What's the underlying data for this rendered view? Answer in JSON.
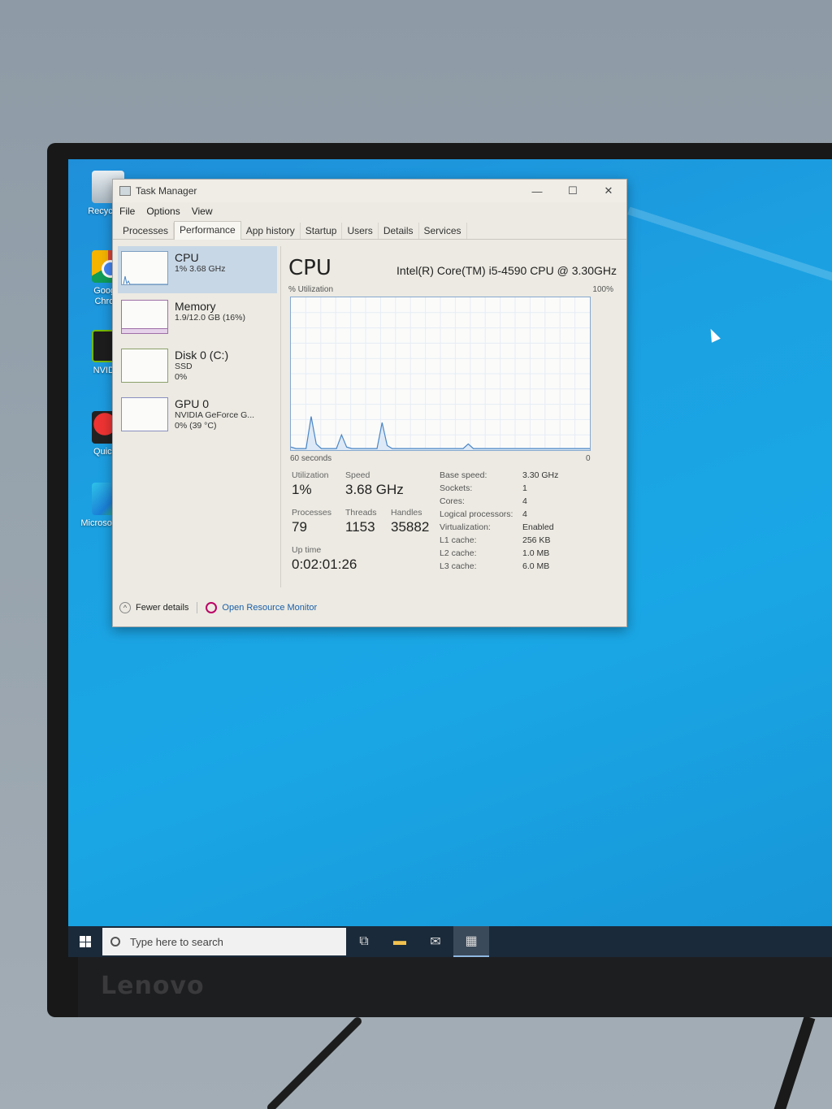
{
  "monitor": {
    "brand": "Lenovo"
  },
  "desktop": {
    "icons": [
      {
        "label": "Recycle B",
        "icon": "recycle-bin-icon"
      },
      {
        "label": "Google Chrom",
        "icon": "chrome-icon"
      },
      {
        "label": "NVIDIA",
        "icon": "nvidia-icon"
      },
      {
        "label": "QuickC",
        "icon": "quickcpu-icon"
      },
      {
        "label": "Microso Edge",
        "icon": "edge-icon"
      }
    ]
  },
  "window": {
    "title": "Task Manager",
    "controls": {
      "minimize": "—",
      "maximize": "☐",
      "close": "✕"
    },
    "menu": [
      "File",
      "Options",
      "View"
    ],
    "tabs": [
      "Processes",
      "Performance",
      "App history",
      "Startup",
      "Users",
      "Details",
      "Services"
    ],
    "active_tab": "Performance"
  },
  "sidebar": {
    "items": [
      {
        "name": "CPU",
        "line1": "1%  3.68 GHz",
        "line2": ""
      },
      {
        "name": "Memory",
        "line1": "1.9/12.0 GB (16%)",
        "line2": ""
      },
      {
        "name": "Disk 0 (C:)",
        "line1": "SSD",
        "line2": "0%"
      },
      {
        "name": "GPU 0",
        "line1": "NVIDIA GeForce G...",
        "line2": "0%  (39 °C)"
      }
    ]
  },
  "cpu": {
    "title": "CPU",
    "model": "Intel(R) Core(TM) i5-4590 CPU @ 3.30GHz",
    "util_label": "% Utilization",
    "util_max": "100%",
    "time_label": "60 seconds",
    "zero_label": "0",
    "history": [
      2,
      1,
      1,
      1,
      22,
      4,
      1,
      1,
      1,
      1,
      10,
      2,
      1,
      1,
      1,
      1,
      1,
      1,
      18,
      3,
      1,
      1,
      1,
      1,
      1,
      1,
      1,
      1,
      1,
      1,
      1,
      1,
      1,
      1,
      1,
      4,
      1,
      1,
      1,
      1,
      1,
      1,
      1,
      1,
      1,
      1,
      1,
      1,
      1,
      1,
      1,
      1,
      1,
      1,
      1,
      1,
      1,
      1,
      1,
      1
    ],
    "stats": {
      "utilization_label": "Utilization",
      "utilization": "1%",
      "speed_label": "Speed",
      "speed": "3.68 GHz",
      "processes_label": "Processes",
      "processes": "79",
      "threads_label": "Threads",
      "threads": "1153",
      "handles_label": "Handles",
      "handles": "35882",
      "uptime_label": "Up time",
      "uptime": "0:02:01:26"
    },
    "specs": [
      {
        "k": "Base speed:",
        "v": "3.30 GHz"
      },
      {
        "k": "Sockets:",
        "v": "1"
      },
      {
        "k": "Cores:",
        "v": "4"
      },
      {
        "k": "Logical processors:",
        "v": "4"
      },
      {
        "k": "Virtualization:",
        "v": "Enabled"
      },
      {
        "k": "L1 cache:",
        "v": "256 KB"
      },
      {
        "k": "L2 cache:",
        "v": "1.0 MB"
      },
      {
        "k": "L3 cache:",
        "v": "6.0 MB"
      }
    ]
  },
  "footer": {
    "fewer": "Fewer details",
    "monitor": "Open Resource Monitor"
  },
  "taskbar": {
    "search_placeholder": "Type here to search"
  },
  "colors": {
    "accent": "#1ba1e2",
    "graph_line": "#4a86c5"
  }
}
